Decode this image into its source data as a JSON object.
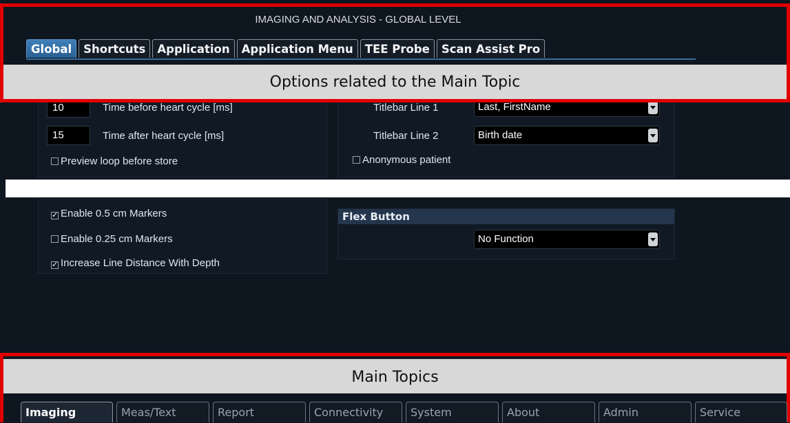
{
  "header": {
    "title": "IMAGING AND ANALYSIS - GLOBAL LEVEL"
  },
  "tabs": [
    {
      "label": "Global",
      "active": true
    },
    {
      "label": "Shortcuts"
    },
    {
      "label": "Application"
    },
    {
      "label": "Application Menu"
    },
    {
      "label": "TEE Probe"
    },
    {
      "label": "Scan Assist Pro"
    }
  ],
  "annotations": {
    "top": "Options related to the Main Topic",
    "bottom": "Main Topics"
  },
  "loop": {
    "before_value": "10",
    "before_label": "Time before heart cycle [ms]",
    "after_value": "15",
    "after_label": "Time after heart cycle [ms]",
    "preview_label": "Preview loop before store",
    "preview_checked": false
  },
  "titlebar": {
    "line1_label": "Titlebar Line 1",
    "line1_value": "Last, FirstName",
    "line2_label": "Titlebar Line 2",
    "line2_value": "Birth date",
    "anonymous_label": "Anonymous patient",
    "anonymous_checked": false
  },
  "markers": {
    "m05_label": "Enable 0.5 cm Markers",
    "m05_checked": true,
    "m025_label": "Enable 0.25 cm Markers",
    "m025_checked": false,
    "depth_label": "Increase Line Distance With Depth",
    "depth_checked": true
  },
  "flex": {
    "title": "Flex Button",
    "value": "No Function"
  },
  "bottom_tabs": [
    {
      "label": "Imaging",
      "active": true
    },
    {
      "label": "Meas/Text"
    },
    {
      "label": "Report"
    },
    {
      "label": "Connectivity"
    },
    {
      "label": "System"
    },
    {
      "label": "About"
    },
    {
      "label": "Admin"
    },
    {
      "label": "Service"
    }
  ],
  "colors": {
    "background": "#0e1620",
    "active_tab": "#2b5f92",
    "annotation_border": "#e00000",
    "annotation_band": "#d8d8d8"
  }
}
